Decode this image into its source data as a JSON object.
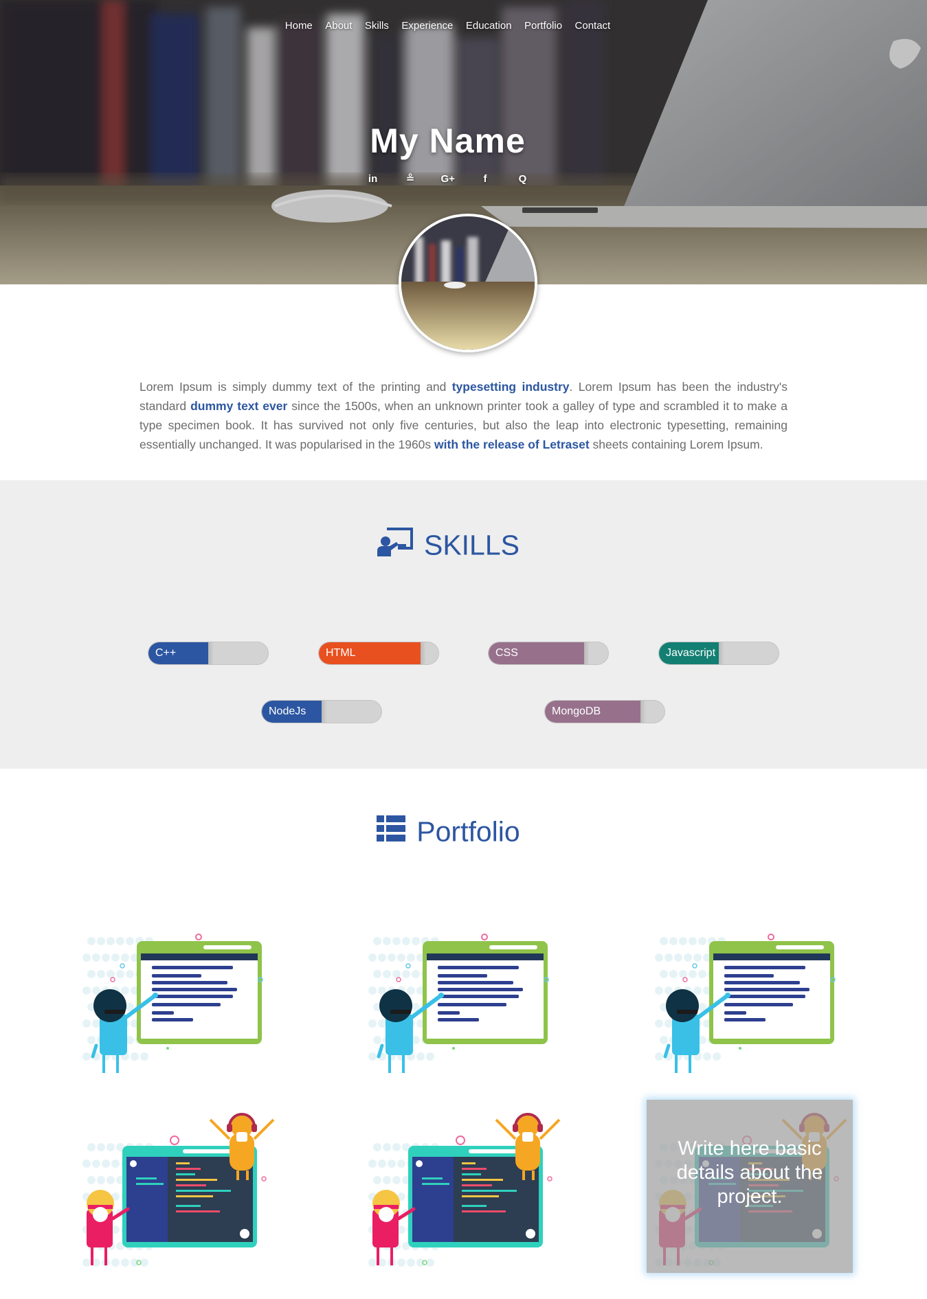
{
  "nav": {
    "items": [
      "Home",
      "About",
      "Skills",
      "Experience",
      "Education",
      "Portfolio",
      "Contact"
    ]
  },
  "hero": {
    "name": "My Name",
    "social": [
      {
        "icon": "linkedin-icon",
        "glyph": "in"
      },
      {
        "icon": "stackoverflow-icon",
        "glyph": "≗"
      },
      {
        "icon": "google-plus-icon",
        "glyph": "G+"
      },
      {
        "icon": "facebook-icon",
        "glyph": "f"
      },
      {
        "icon": "quora-icon",
        "glyph": "Q"
      }
    ]
  },
  "about": {
    "parts": [
      {
        "text": "Lorem Ipsum is simply dummy text of the printing and ",
        "bold": false
      },
      {
        "text": "typesetting industry",
        "bold": true
      },
      {
        "text": ". Lorem Ipsum has been the industry's standard ",
        "bold": false
      },
      {
        "text": "dummy text ever",
        "bold": true
      },
      {
        "text": " since the 1500s, when an unknown printer took a galley of type and scrambled it to make a type specimen book. It has survived not only five centuries, but also the leap into electronic typesetting, remaining essentially unchanged. It was popularised in the 1960s ",
        "bold": false
      },
      {
        "text": "with the release of Letraset",
        "bold": true
      },
      {
        "text": " sheets containing Lorem Ipsum.",
        "bold": false
      }
    ]
  },
  "skills": {
    "title": "SKILLS",
    "items": [
      {
        "label": "C++",
        "level": 0.5,
        "color": "#2c56a1"
      },
      {
        "label": "HTML",
        "level": 0.85,
        "color": "#e8501f"
      },
      {
        "label": "CSS",
        "level": 0.8,
        "color": "#97718c"
      },
      {
        "label": "Javascript",
        "level": 0.5,
        "color": "#137f73"
      },
      {
        "label": "NodeJs",
        "level": 0.5,
        "color": "#2c56a1"
      },
      {
        "label": "MongoDB",
        "level": 0.8,
        "color": "#97718c"
      }
    ]
  },
  "portfolio": {
    "title": "Portfolio",
    "overlay_text": "Write here basic details about the project."
  },
  "colors": {
    "accent": "#2c56a1"
  }
}
